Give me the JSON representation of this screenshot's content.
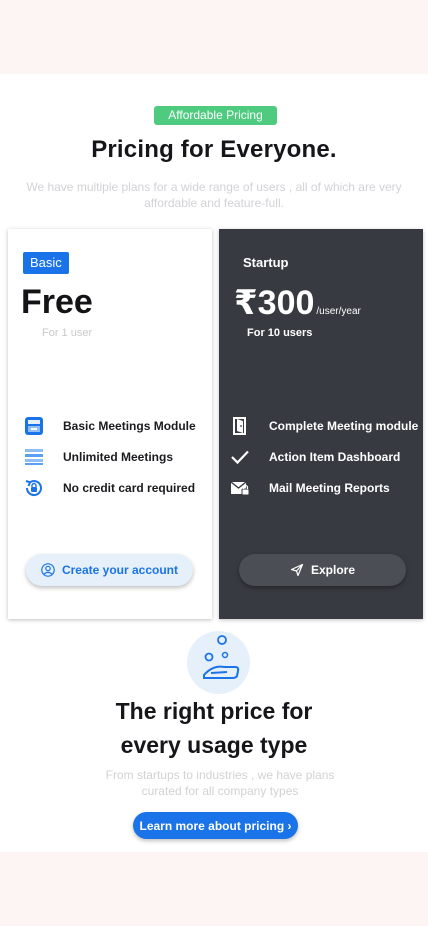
{
  "header": {
    "badge": "Affordable Pricing",
    "title": "Pricing for Everyone.",
    "subtitle": "We have multiple plans for a wide range of users , all of which are very affordable and feature-full."
  },
  "plans": [
    {
      "name": "Basic",
      "price": "Free",
      "users": "For 1 user",
      "features": [
        {
          "icon": "meetings-module-icon",
          "label": "Basic Meetings Module"
        },
        {
          "icon": "list-icon",
          "label": "Unlimited Meetings"
        },
        {
          "icon": "lock-refresh-icon",
          "label": "No credit card required"
        }
      ],
      "cta": "Create your account"
    },
    {
      "name": "Startup",
      "price": "₹300",
      "per": "/user/year",
      "users": "For 10 users",
      "features": [
        {
          "icon": "door-icon",
          "label": "Complete Meeting module"
        },
        {
          "icon": "check-icon",
          "label": "Action Item Dashboard"
        },
        {
          "icon": "mail-lock-icon",
          "label": "Mail Meeting Reports"
        }
      ],
      "cta": "Explore"
    }
  ],
  "usage": {
    "title_line1": "The right price for",
    "title_line2": "every usage type",
    "subtitle": "From startups to industries , we have plans curated for all company types",
    "button": "Learn more about pricing ›"
  },
  "colors": {
    "accent": "#1a73e8",
    "green_badge": "#4ecb7f",
    "dark_card": "#373a40"
  }
}
